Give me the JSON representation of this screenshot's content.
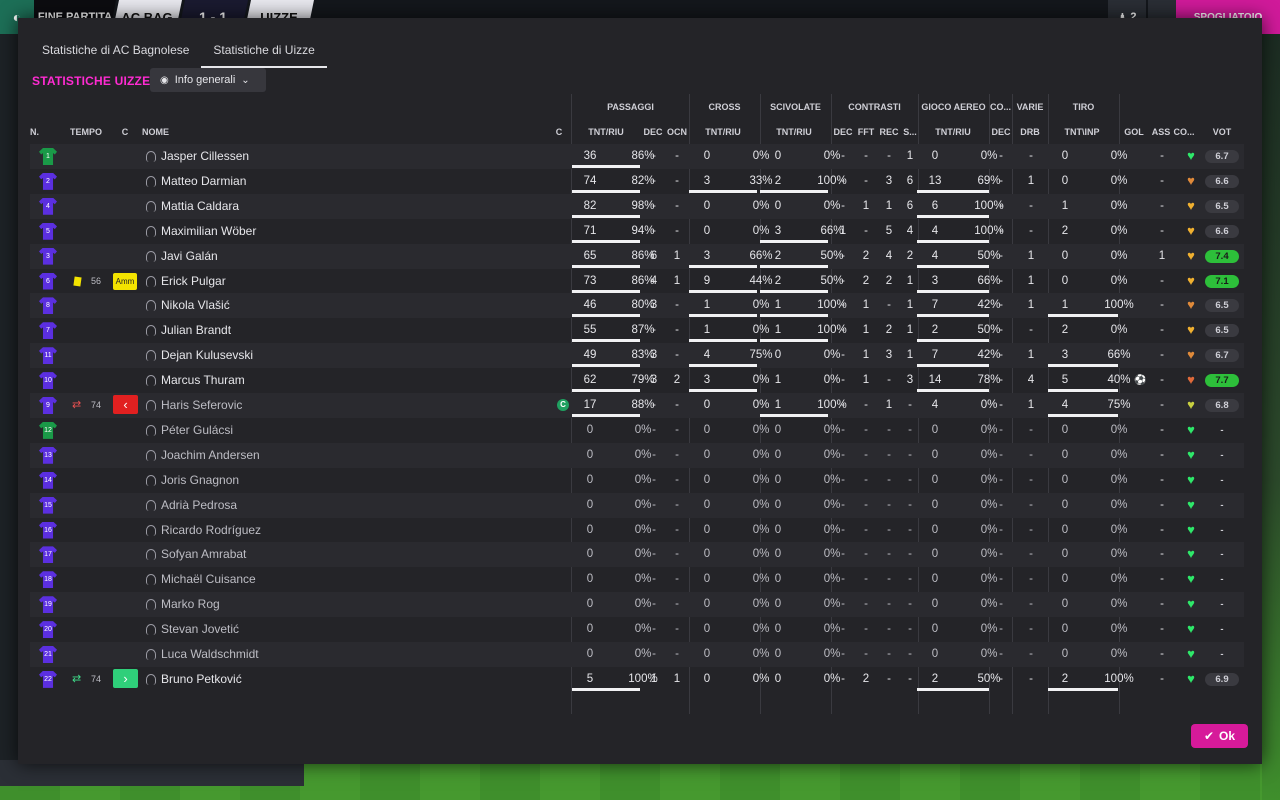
{
  "topbar": {
    "full_time": "FINE PARTITA",
    "home_short": "AC BAG",
    "score": "1 - 1",
    "away_short": "UIZZE",
    "people_count": "2",
    "dressing_room": "SPOGLIATOIO"
  },
  "tabs": [
    {
      "label": "Statistiche di AC Bagnolese",
      "active": false
    },
    {
      "label": "Statistiche di Uizze",
      "active": true
    }
  ],
  "section_title": "STATISTICHE UIZZE",
  "view_dropdown": {
    "label": "Info generali"
  },
  "ok_label": "Ok",
  "colors": {
    "accent": "#ff2bd2",
    "ok_button": "#d61a9a",
    "vote_high": "#2dbf3a",
    "shirt": "#5b2fe0",
    "gk_shirt": "#1a9a48",
    "yellow_card": "#f3e300"
  },
  "groups": {
    "passaggi": "PASSAGGI",
    "cross": "CROSS",
    "scivolate": "SCIVOLATE",
    "contrasti": "CONTRASTI",
    "gioco_aereo": "GIOCO AEREO",
    "co": "CO...",
    "varie": "VARIE",
    "tiro": "TIRO"
  },
  "columns": {
    "n": "N.",
    "tempo": "TEMPO",
    "c": "C",
    "nome": "NOME",
    "cap": "C",
    "pass_tr": "TNT/RIU",
    "pass_dec": "DEC",
    "pass_ocn": "OCN",
    "cross_tr": "TNT/RIU",
    "sciv_tr": "TNT/RIU",
    "con_dec": "DEC",
    "con_fft": "FFT",
    "con_rec": "REC",
    "con_s": "S...",
    "aereo_tr": "TNT/RIU",
    "co_dec": "DEC",
    "varie_drb": "DRB",
    "tiro_ti": "TNT\\INP",
    "gol": "GOL",
    "ass": "ASS",
    "cond": "CO...",
    "vot": "VOT"
  },
  "players": [
    {
      "num": "1",
      "gk": true,
      "name": "Jasper Cillessen",
      "played": true,
      "pass": [
        "36",
        "86%"
      ],
      "pass_bar": true,
      "pdec": "-",
      "pocn": "-",
      "cross": [
        "0",
        "0%"
      ],
      "cross_bar": false,
      "sciv": [
        "0",
        "0%"
      ],
      "sciv_bar": false,
      "con": [
        "-",
        "-",
        "-",
        "1"
      ],
      "aereo": [
        "0",
        "0%"
      ],
      "aereo_bar": false,
      "codec": "-",
      "drb": "-",
      "tiro": [
        "0",
        "0%"
      ],
      "tiro_bar": false,
      "gol": "",
      "ass": "-",
      "heart": "#2ee86a",
      "vot": "6.7",
      "vot_green": false
    },
    {
      "num": "2",
      "gk": false,
      "name": "Matteo Darmian",
      "played": true,
      "pass": [
        "74",
        "82%"
      ],
      "pass_bar": true,
      "pdec": "-",
      "pocn": "-",
      "cross": [
        "3",
        "33%"
      ],
      "cross_bar": true,
      "sciv": [
        "2",
        "100%"
      ],
      "sciv_bar": true,
      "con": [
        "-",
        "-",
        "3",
        "6"
      ],
      "aereo": [
        "13",
        "69%"
      ],
      "aereo_bar": true,
      "codec": "-",
      "drb": "1",
      "tiro": [
        "0",
        "0%"
      ],
      "tiro_bar": false,
      "gol": "",
      "ass": "-",
      "heart": "#e08a3a",
      "vot": "6.6",
      "vot_green": false
    },
    {
      "num": "4",
      "gk": false,
      "name": "Mattia Caldara",
      "played": true,
      "pass": [
        "82",
        "98%"
      ],
      "pass_bar": true,
      "pdec": "-",
      "pocn": "-",
      "cross": [
        "0",
        "0%"
      ],
      "cross_bar": false,
      "sciv": [
        "0",
        "0%"
      ],
      "sciv_bar": false,
      "con": [
        "-",
        "1",
        "1",
        "6"
      ],
      "aereo": [
        "6",
        "100%"
      ],
      "aereo_bar": true,
      "codec": "-",
      "drb": "-",
      "tiro": [
        "1",
        "0%"
      ],
      "tiro_bar": false,
      "gol": "",
      "ass": "-",
      "heart": "#f0b030",
      "vot": "6.5",
      "vot_green": false
    },
    {
      "num": "5",
      "gk": false,
      "name": "Maximilian Wöber",
      "played": true,
      "pass": [
        "71",
        "94%"
      ],
      "pass_bar": true,
      "pdec": "-",
      "pocn": "-",
      "cross": [
        "0",
        "0%"
      ],
      "cross_bar": false,
      "sciv": [
        "3",
        "66%"
      ],
      "sciv_bar": true,
      "con": [
        "1",
        "-",
        "5",
        "4"
      ],
      "aereo": [
        "4",
        "100%"
      ],
      "aereo_bar": true,
      "codec": "-",
      "drb": "-",
      "tiro": [
        "2",
        "0%"
      ],
      "tiro_bar": false,
      "gol": "",
      "ass": "-",
      "heart": "#f0b030",
      "vot": "6.6",
      "vot_green": false
    },
    {
      "num": "3",
      "gk": false,
      "name": "Javi Galán",
      "played": true,
      "pass": [
        "65",
        "86%"
      ],
      "pass_bar": true,
      "pdec": "6",
      "pocn": "1",
      "cross": [
        "3",
        "66%"
      ],
      "cross_bar": true,
      "sciv": [
        "2",
        "50%"
      ],
      "sciv_bar": true,
      "con": [
        "-",
        "2",
        "4",
        "2"
      ],
      "aereo": [
        "4",
        "50%"
      ],
      "aereo_bar": true,
      "codec": "-",
      "drb": "1",
      "tiro": [
        "0",
        "0%"
      ],
      "tiro_bar": false,
      "gol": "",
      "ass": "1",
      "heart": "#f0b030",
      "vot": "7.4",
      "vot_green": true
    },
    {
      "num": "6",
      "gk": false,
      "name": "Erick Pulgar",
      "played": true,
      "yellow": true,
      "tempo": "56",
      "ammlabel": "Amm",
      "pass": [
        "73",
        "86%"
      ],
      "pass_bar": true,
      "pdec": "4",
      "pocn": "1",
      "cross": [
        "9",
        "44%"
      ],
      "cross_bar": true,
      "sciv": [
        "2",
        "50%"
      ],
      "sciv_bar": true,
      "con": [
        "-",
        "2",
        "2",
        "1"
      ],
      "aereo": [
        "3",
        "66%"
      ],
      "aereo_bar": true,
      "codec": "-",
      "drb": "1",
      "tiro": [
        "0",
        "0%"
      ],
      "tiro_bar": false,
      "gol": "",
      "ass": "-",
      "heart": "#f0b030",
      "vot": "7.1",
      "vot_green": true
    },
    {
      "num": "8",
      "gk": false,
      "name": "Nikola Vlašić",
      "played": true,
      "pass": [
        "46",
        "80%"
      ],
      "pass_bar": true,
      "pdec": "3",
      "pocn": "-",
      "cross": [
        "1",
        "0%"
      ],
      "cross_bar": true,
      "sciv": [
        "1",
        "100%"
      ],
      "sciv_bar": true,
      "con": [
        "-",
        "1",
        "-",
        "1"
      ],
      "aereo": [
        "7",
        "42%"
      ],
      "aereo_bar": true,
      "codec": "-",
      "drb": "1",
      "tiro": [
        "1",
        "100%"
      ],
      "tiro_bar": true,
      "gol": "",
      "ass": "-",
      "heart": "#e08a3a",
      "vot": "6.5",
      "vot_green": false
    },
    {
      "num": "7",
      "gk": false,
      "name": "Julian Brandt",
      "played": true,
      "pass": [
        "55",
        "87%"
      ],
      "pass_bar": true,
      "pdec": "-",
      "pocn": "-",
      "cross": [
        "1",
        "0%"
      ],
      "cross_bar": true,
      "sciv": [
        "1",
        "100%"
      ],
      "sciv_bar": true,
      "con": [
        "-",
        "1",
        "2",
        "1"
      ],
      "aereo": [
        "2",
        "50%"
      ],
      "aereo_bar": true,
      "codec": "-",
      "drb": "-",
      "tiro": [
        "2",
        "0%"
      ],
      "tiro_bar": false,
      "gol": "",
      "ass": "-",
      "heart": "#f0b030",
      "vot": "6.5",
      "vot_green": false
    },
    {
      "num": "11",
      "gk": false,
      "name": "Dejan Kulusevski",
      "played": true,
      "pass": [
        "49",
        "83%"
      ],
      "pass_bar": true,
      "pdec": "3",
      "pocn": "-",
      "cross": [
        "4",
        "75%"
      ],
      "cross_bar": true,
      "sciv": [
        "0",
        "0%"
      ],
      "sciv_bar": false,
      "con": [
        "-",
        "1",
        "3",
        "1"
      ],
      "aereo": [
        "7",
        "42%"
      ],
      "aereo_bar": true,
      "codec": "-",
      "drb": "1",
      "tiro": [
        "3",
        "66%"
      ],
      "tiro_bar": true,
      "gol": "",
      "ass": "-",
      "heart": "#e08a3a",
      "vot": "6.7",
      "vot_green": false
    },
    {
      "num": "10",
      "gk": false,
      "name": "Marcus Thuram",
      "played": true,
      "pass": [
        "62",
        "79%"
      ],
      "pass_bar": true,
      "pdec": "3",
      "pocn": "2",
      "cross": [
        "3",
        "0%"
      ],
      "cross_bar": true,
      "sciv": [
        "1",
        "0%"
      ],
      "sciv_bar": false,
      "con": [
        "-",
        "1",
        "-",
        "3"
      ],
      "aereo": [
        "14",
        "78%"
      ],
      "aereo_bar": true,
      "codec": "-",
      "drb": "4",
      "tiro": [
        "5",
        "40%"
      ],
      "tiro_bar": true,
      "gol": "ball",
      "ass": "-",
      "heart": "#e06a3a",
      "vot": "7.7",
      "vot_green": true
    },
    {
      "num": "9",
      "gk": false,
      "name": "Haris Seferovic",
      "played": true,
      "subout": true,
      "tempo": "74",
      "captain": "C",
      "pass": [
        "17",
        "88%"
      ],
      "pass_bar": true,
      "pdec": "-",
      "pocn": "-",
      "cross": [
        "0",
        "0%"
      ],
      "cross_bar": false,
      "sciv": [
        "1",
        "100%"
      ],
      "sciv_bar": true,
      "con": [
        "-",
        "-",
        "1",
        "-"
      ],
      "aereo": [
        "4",
        "0%"
      ],
      "aereo_bar": false,
      "codec": "-",
      "drb": "1",
      "tiro": [
        "4",
        "75%"
      ],
      "tiro_bar": true,
      "gol": "",
      "ass": "-",
      "heart": "#c8d040",
      "vot": "6.8",
      "vot_green": false
    },
    {
      "num": "12",
      "gk": true,
      "name": "Péter Gulácsi",
      "played": false,
      "pass": [
        "0",
        "0%"
      ],
      "pass_bar": false,
      "pdec": "-",
      "pocn": "-",
      "cross": [
        "0",
        "0%"
      ],
      "cross_bar": false,
      "sciv": [
        "0",
        "0%"
      ],
      "sciv_bar": false,
      "con": [
        "-",
        "-",
        "-",
        "-"
      ],
      "aereo": [
        "0",
        "0%"
      ],
      "aereo_bar": false,
      "codec": "-",
      "drb": "-",
      "tiro": [
        "0",
        "0%"
      ],
      "tiro_bar": false,
      "gol": "",
      "ass": "-",
      "heart": "#2ee86a",
      "vot": "-",
      "vot_green": false
    },
    {
      "num": "13",
      "gk": false,
      "name": "Joachim Andersen",
      "played": false,
      "pass": [
        "0",
        "0%"
      ],
      "pass_bar": false,
      "pdec": "-",
      "pocn": "-",
      "cross": [
        "0",
        "0%"
      ],
      "cross_bar": false,
      "sciv": [
        "0",
        "0%"
      ],
      "sciv_bar": false,
      "con": [
        "-",
        "-",
        "-",
        "-"
      ],
      "aereo": [
        "0",
        "0%"
      ],
      "aereo_bar": false,
      "codec": "-",
      "drb": "-",
      "tiro": [
        "0",
        "0%"
      ],
      "tiro_bar": false,
      "gol": "",
      "ass": "-",
      "heart": "#2ee86a",
      "vot": "-",
      "vot_green": false
    },
    {
      "num": "14",
      "gk": false,
      "name": "Joris Gnagnon",
      "played": false,
      "pass": [
        "0",
        "0%"
      ],
      "pass_bar": false,
      "pdec": "-",
      "pocn": "-",
      "cross": [
        "0",
        "0%"
      ],
      "cross_bar": false,
      "sciv": [
        "0",
        "0%"
      ],
      "sciv_bar": false,
      "con": [
        "-",
        "-",
        "-",
        "-"
      ],
      "aereo": [
        "0",
        "0%"
      ],
      "aereo_bar": false,
      "codec": "-",
      "drb": "-",
      "tiro": [
        "0",
        "0%"
      ],
      "tiro_bar": false,
      "gol": "",
      "ass": "-",
      "heart": "#2ee86a",
      "vot": "-",
      "vot_green": false
    },
    {
      "num": "15",
      "gk": false,
      "name": "Adrià Pedrosa",
      "played": false,
      "pass": [
        "0",
        "0%"
      ],
      "pass_bar": false,
      "pdec": "-",
      "pocn": "-",
      "cross": [
        "0",
        "0%"
      ],
      "cross_bar": false,
      "sciv": [
        "0",
        "0%"
      ],
      "sciv_bar": false,
      "con": [
        "-",
        "-",
        "-",
        "-"
      ],
      "aereo": [
        "0",
        "0%"
      ],
      "aereo_bar": false,
      "codec": "-",
      "drb": "-",
      "tiro": [
        "0",
        "0%"
      ],
      "tiro_bar": false,
      "gol": "",
      "ass": "-",
      "heart": "#2ee86a",
      "vot": "-",
      "vot_green": false
    },
    {
      "num": "16",
      "gk": false,
      "name": "Ricardo Rodríguez",
      "played": false,
      "pass": [
        "0",
        "0%"
      ],
      "pass_bar": false,
      "pdec": "-",
      "pocn": "-",
      "cross": [
        "0",
        "0%"
      ],
      "cross_bar": false,
      "sciv": [
        "0",
        "0%"
      ],
      "sciv_bar": false,
      "con": [
        "-",
        "-",
        "-",
        "-"
      ],
      "aereo": [
        "0",
        "0%"
      ],
      "aereo_bar": false,
      "codec": "-",
      "drb": "-",
      "tiro": [
        "0",
        "0%"
      ],
      "tiro_bar": false,
      "gol": "",
      "ass": "-",
      "heart": "#2ee86a",
      "vot": "-",
      "vot_green": false
    },
    {
      "num": "17",
      "gk": false,
      "name": "Sofyan Amrabat",
      "played": false,
      "pass": [
        "0",
        "0%"
      ],
      "pass_bar": false,
      "pdec": "-",
      "pocn": "-",
      "cross": [
        "0",
        "0%"
      ],
      "cross_bar": false,
      "sciv": [
        "0",
        "0%"
      ],
      "sciv_bar": false,
      "con": [
        "-",
        "-",
        "-",
        "-"
      ],
      "aereo": [
        "0",
        "0%"
      ],
      "aereo_bar": false,
      "codec": "-",
      "drb": "-",
      "tiro": [
        "0",
        "0%"
      ],
      "tiro_bar": false,
      "gol": "",
      "ass": "-",
      "heart": "#2ee86a",
      "vot": "-",
      "vot_green": false
    },
    {
      "num": "18",
      "gk": false,
      "name": "Michaël Cuisance",
      "played": false,
      "pass": [
        "0",
        "0%"
      ],
      "pass_bar": false,
      "pdec": "-",
      "pocn": "-",
      "cross": [
        "0",
        "0%"
      ],
      "cross_bar": false,
      "sciv": [
        "0",
        "0%"
      ],
      "sciv_bar": false,
      "con": [
        "-",
        "-",
        "-",
        "-"
      ],
      "aereo": [
        "0",
        "0%"
      ],
      "aereo_bar": false,
      "codec": "-",
      "drb": "-",
      "tiro": [
        "0",
        "0%"
      ],
      "tiro_bar": false,
      "gol": "",
      "ass": "-",
      "heart": "#2ee86a",
      "vot": "-",
      "vot_green": false
    },
    {
      "num": "19",
      "gk": false,
      "name": "Marko Rog",
      "played": false,
      "pass": [
        "0",
        "0%"
      ],
      "pass_bar": false,
      "pdec": "-",
      "pocn": "-",
      "cross": [
        "0",
        "0%"
      ],
      "cross_bar": false,
      "sciv": [
        "0",
        "0%"
      ],
      "sciv_bar": false,
      "con": [
        "-",
        "-",
        "-",
        "-"
      ],
      "aereo": [
        "0",
        "0%"
      ],
      "aereo_bar": false,
      "codec": "-",
      "drb": "-",
      "tiro": [
        "0",
        "0%"
      ],
      "tiro_bar": false,
      "gol": "",
      "ass": "-",
      "heart": "#2ee86a",
      "vot": "-",
      "vot_green": false
    },
    {
      "num": "20",
      "gk": false,
      "name": "Stevan Jovetić",
      "played": false,
      "pass": [
        "0",
        "0%"
      ],
      "pass_bar": false,
      "pdec": "-",
      "pocn": "-",
      "cross": [
        "0",
        "0%"
      ],
      "cross_bar": false,
      "sciv": [
        "0",
        "0%"
      ],
      "sciv_bar": false,
      "con": [
        "-",
        "-",
        "-",
        "-"
      ],
      "aereo": [
        "0",
        "0%"
      ],
      "aereo_bar": false,
      "codec": "-",
      "drb": "-",
      "tiro": [
        "0",
        "0%"
      ],
      "tiro_bar": false,
      "gol": "",
      "ass": "-",
      "heart": "#2ee86a",
      "vot": "-",
      "vot_green": false
    },
    {
      "num": "21",
      "gk": false,
      "name": "Luca Waldschmidt",
      "played": false,
      "pass": [
        "0",
        "0%"
      ],
      "pass_bar": false,
      "pdec": "-",
      "pocn": "-",
      "cross": [
        "0",
        "0%"
      ],
      "cross_bar": false,
      "sciv": [
        "0",
        "0%"
      ],
      "sciv_bar": false,
      "con": [
        "-",
        "-",
        "-",
        "-"
      ],
      "aereo": [
        "0",
        "0%"
      ],
      "aereo_bar": false,
      "codec": "-",
      "drb": "-",
      "tiro": [
        "0",
        "0%"
      ],
      "tiro_bar": false,
      "gol": "",
      "ass": "-",
      "heart": "#2ee86a",
      "vot": "-",
      "vot_green": false
    },
    {
      "num": "22",
      "gk": false,
      "name": "Bruno Petković",
      "played": true,
      "subin": true,
      "tempo": "74",
      "pass": [
        "5",
        "100%"
      ],
      "pass_bar": true,
      "pdec": "1",
      "pocn": "1",
      "cross": [
        "0",
        "0%"
      ],
      "cross_bar": false,
      "sciv": [
        "0",
        "0%"
      ],
      "sciv_bar": false,
      "con": [
        "-",
        "2",
        "-",
        "-"
      ],
      "aereo": [
        "2",
        "50%"
      ],
      "aereo_bar": true,
      "codec": "-",
      "drb": "-",
      "tiro": [
        "2",
        "100%"
      ],
      "tiro_bar": true,
      "gol": "",
      "ass": "-",
      "heart": "#2ee86a",
      "vot": "6.9",
      "vot_green": false
    }
  ]
}
